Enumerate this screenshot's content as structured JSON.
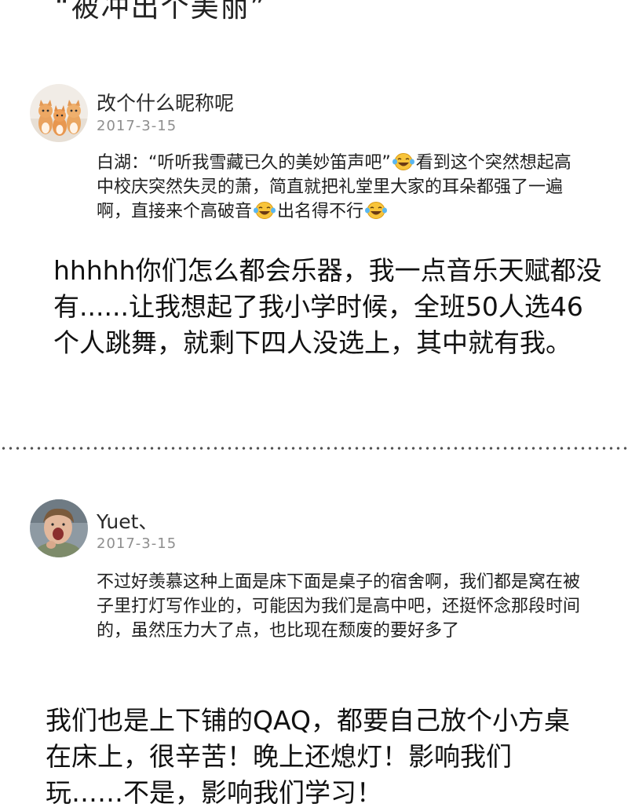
{
  "header_fragment": "“被冲出个美丽”",
  "posts": [
    {
      "username": "改个什么昵称呢",
      "date": "2017-3-15",
      "comment": {
        "part1": "白湖：“听听我雪藏已久的美妙笛声吧”",
        "part2": "看到这个突然想起高中校庆突然失灵的萧，简直就把礼堂里大家的耳朵都强了一遍啊，直接来个高破音",
        "part3": "出名得不行",
        "emoji": "tears-of-joy-emoji"
      },
      "reply": "hhhhh你们怎么都会乐器，我一点音乐天赋都没有......让我想起了我小学时候，全班50人选46个人跳舞，就剩下四人没选上，其中就有我。"
    },
    {
      "username": "Yuet、",
      "date": "2017-3-15",
      "comment": "不过好羡慕这种上面是床下面是桌子的宿舍啊，我们都是窝在被子里打灯写作业的，可能因为我们是高中吧，还挺怀念那段时间的，虽然压力大了点，也比现在颓废的要好多了",
      "reply": "我们也是上下铺的QAQ，都要自己放个小方桌在床上，很辛苦！晚上还熄灯！影响我们玩……不是，影响我们学习！"
    }
  ]
}
